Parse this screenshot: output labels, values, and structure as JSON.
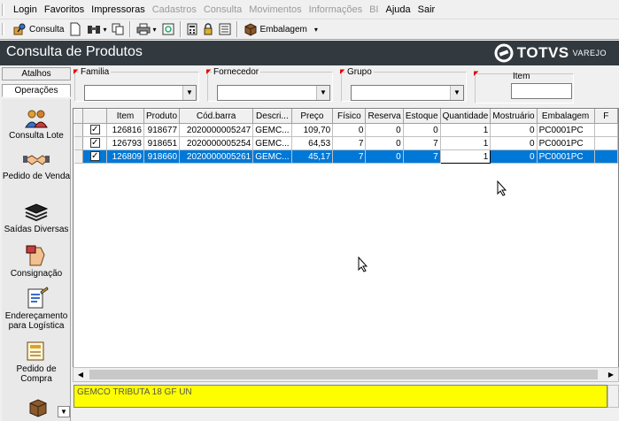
{
  "menubar": {
    "items": [
      {
        "label": "Login",
        "disabled": false
      },
      {
        "label": "Favoritos",
        "disabled": false
      },
      {
        "label": "Impressoras",
        "disabled": false
      },
      {
        "label": "Cadastros",
        "disabled": true
      },
      {
        "label": "Consulta",
        "disabled": true
      },
      {
        "label": "Movimentos",
        "disabled": true
      },
      {
        "label": "Informações",
        "disabled": true
      },
      {
        "label": "BI",
        "disabled": true
      },
      {
        "label": "Ajuda",
        "disabled": false
      },
      {
        "label": "Sair",
        "disabled": false
      }
    ]
  },
  "toolbar": {
    "consulta_label": "Consulta",
    "embalagem_label": "Embalagem"
  },
  "header": {
    "title": "Consulta de Produtos",
    "brand": "TOTVS",
    "brand_sub": "VAREJO"
  },
  "sidebar": {
    "tabs": [
      "Atalhos",
      "Operações"
    ],
    "items": [
      {
        "label": "Consulta Lote",
        "icon": "people-icon"
      },
      {
        "label": "Pedido de Venda",
        "icon": "handshake-icon"
      },
      {
        "label": "Saídas Diversas",
        "icon": "stack-icon"
      },
      {
        "label": "Consignação",
        "icon": "hand-icon"
      },
      {
        "label": "Endereçamento para Logística",
        "icon": "clipboard-icon"
      },
      {
        "label": "Pedido de Compra",
        "icon": "order-icon"
      }
    ]
  },
  "filters": {
    "familia_label": "Familia",
    "fornecedor_label": "Fornecedor",
    "grupo_label": "Grupo",
    "item_label": "Item"
  },
  "grid": {
    "columns": [
      "",
      "Item",
      "Produto",
      "Cód.barra",
      "Descri...",
      "Preço",
      "Físico",
      "Reserva",
      "Estoque",
      "Quantidade",
      "Mostruário",
      "Embalagem",
      "F"
    ],
    "rows": [
      {
        "checked": true,
        "item": "126816",
        "produto": "918677",
        "codbarra": "2020000005247",
        "descricao": "GEMC...",
        "preco": "109,70",
        "fisico": "0",
        "reserva": "0",
        "estoque": "0",
        "quantidade": "1",
        "mostruario": "0",
        "embalagem": "PC0001PC",
        "selected": false
      },
      {
        "checked": true,
        "item": "126793",
        "produto": "918651",
        "codbarra": "2020000005254",
        "descricao": "GEMC...",
        "preco": "64,53",
        "fisico": "7",
        "reserva": "0",
        "estoque": "7",
        "quantidade": "1",
        "mostruario": "0",
        "embalagem": "PC0001PC",
        "selected": false
      },
      {
        "checked": true,
        "item": "126809",
        "produto": "918660",
        "codbarra": "2020000005261",
        "descricao": "GEMC...",
        "preco": "45,17",
        "fisico": "7",
        "reserva": "0",
        "estoque": "7",
        "quantidade": "1",
        "mostruario": "0",
        "embalagem": "PC0001PC",
        "selected": true
      }
    ]
  },
  "status": {
    "text": "GEMCO TRIBUTA 18  GF UN"
  },
  "colors": {
    "header_bg": "#323a40",
    "selection": "#0078d7",
    "status_bg": "#fffe00"
  }
}
